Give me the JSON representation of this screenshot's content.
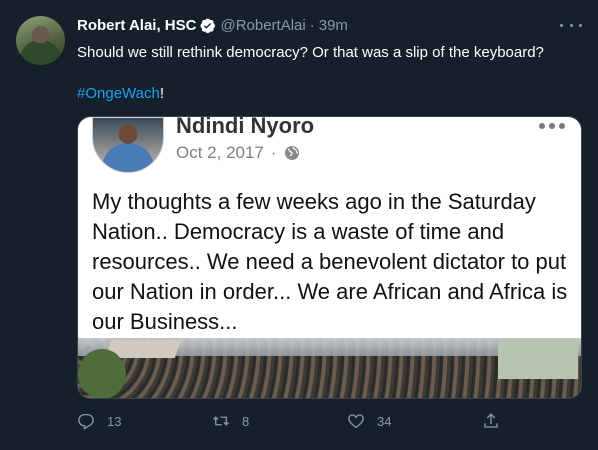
{
  "tweet": {
    "display_name": "Robert Alai, HSC",
    "handle": "@RobertAlai",
    "separator": "·",
    "time": "39m",
    "text": "Should we still rethink democracy? Or that was a slip of the keyboard?",
    "hashtag": "#OngeWach",
    "hashtag_suffix": "!"
  },
  "media": {
    "fb_name": "Ndindi Nyoro",
    "fb_date": "Oct 2, 2017",
    "fb_sep": "·",
    "fb_text": "My thoughts a few weeks ago in the Saturday Nation.. Democracy is a waste of time and resources.. We need a benevolent dictator to put our Nation in order... We are African and Africa is our Business..."
  },
  "actions": {
    "reply_count": "13",
    "retweet_count": "8",
    "like_count": "34"
  },
  "colors": {
    "background": "#15202b",
    "link": "#1da1f2",
    "muted": "#8899a6",
    "verified": "#1da1f2"
  },
  "icons": [
    "verified-badge-icon",
    "more-icon",
    "globe-icon",
    "reply-icon",
    "retweet-icon",
    "like-icon",
    "share-icon"
  ]
}
